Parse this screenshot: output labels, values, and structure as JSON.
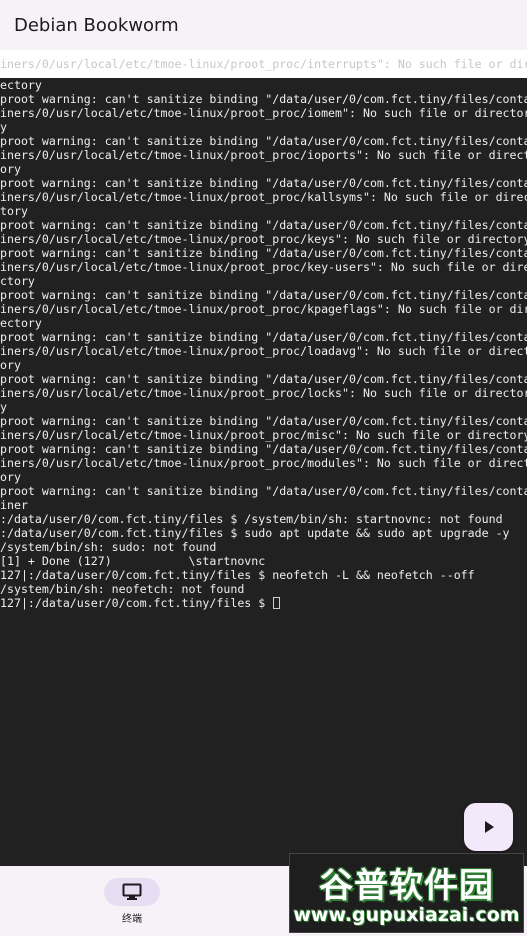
{
  "app_bar": {
    "title": "Debian Bookworm"
  },
  "terminal": {
    "faded_line": "iners/0/usr/local/etc/tmoe-linux/proot_proc/interrupts\": No such file or dir",
    "lines": [
      "ectory",
      "proot warning: can't sanitize binding \"/data/user/0/com.fct.tiny/files/conta",
      "iners/0/usr/local/etc/tmoe-linux/proot_proc/iomem\": No such file or director",
      "y",
      "proot warning: can't sanitize binding \"/data/user/0/com.fct.tiny/files/conta",
      "iners/0/usr/local/etc/tmoe-linux/proot_proc/ioports\": No such file or direct",
      "ory",
      "proot warning: can't sanitize binding \"/data/user/0/com.fct.tiny/files/conta",
      "iners/0/usr/local/etc/tmoe-linux/proot_proc/kallsyms\": No such file or direc",
      "tory",
      "proot warning: can't sanitize binding \"/data/user/0/com.fct.tiny/files/conta",
      "iners/0/usr/local/etc/tmoe-linux/proot_proc/keys\": No such file or directory",
      "proot warning: can't sanitize binding \"/data/user/0/com.fct.tiny/files/conta",
      "iners/0/usr/local/etc/tmoe-linux/proot_proc/key-users\": No such file or dire",
      "ctory",
      "proot warning: can't sanitize binding \"/data/user/0/com.fct.tiny/files/conta",
      "iners/0/usr/local/etc/tmoe-linux/proot_proc/kpageflags\": No such file or dir",
      "ectory",
      "proot warning: can't sanitize binding \"/data/user/0/com.fct.tiny/files/conta",
      "iners/0/usr/local/etc/tmoe-linux/proot_proc/loadavg\": No such file or direct",
      "ory",
      "proot warning: can't sanitize binding \"/data/user/0/com.fct.tiny/files/conta",
      "iners/0/usr/local/etc/tmoe-linux/proot_proc/locks\": No such file or director",
      "y",
      "proot warning: can't sanitize binding \"/data/user/0/com.fct.tiny/files/conta",
      "iners/0/usr/local/etc/tmoe-linux/proot_proc/misc\": No such file or directory",
      "proot warning: can't sanitize binding \"/data/user/0/com.fct.tiny/files/conta",
      "iners/0/usr/local/etc/tmoe-linux/proot_proc/modules\": No such file or direct",
      "ory",
      "proot warning: can't sanitize binding \"/data/user/0/com.fct.tiny/files/conta",
      "iner",
      ":/data/user/0/com.fct.tiny/files $ /system/bin/sh: startnovnc: not found",
      ":/data/user/0/com.fct.tiny/files $ sudo apt update && sudo apt upgrade -y",
      "/system/bin/sh: sudo: not found",
      "[1] + Done (127)           \\startnovnc",
      "127|:/data/user/0/com.fct.tiny/files $ neofetch -L && neofetch --off",
      "/system/bin/sh: neofetch: not found"
    ],
    "prompt_line": "127|:/data/user/0/com.fct.tiny/files $ "
  },
  "fab": {
    "icon": "play-icon"
  },
  "bottom_nav": {
    "items": [
      {
        "icon": "monitor-icon",
        "label": "终端"
      }
    ]
  },
  "watermark": {
    "title": "谷普软件园",
    "url": "www.gupuxiazai.com"
  },
  "colors": {
    "terminal_bg": "#212121",
    "terminal_text": "#eeeeee",
    "app_bg": "#f6f2f7",
    "accent_container": "#f3e9fb",
    "nav_indicator": "#e7def3"
  }
}
